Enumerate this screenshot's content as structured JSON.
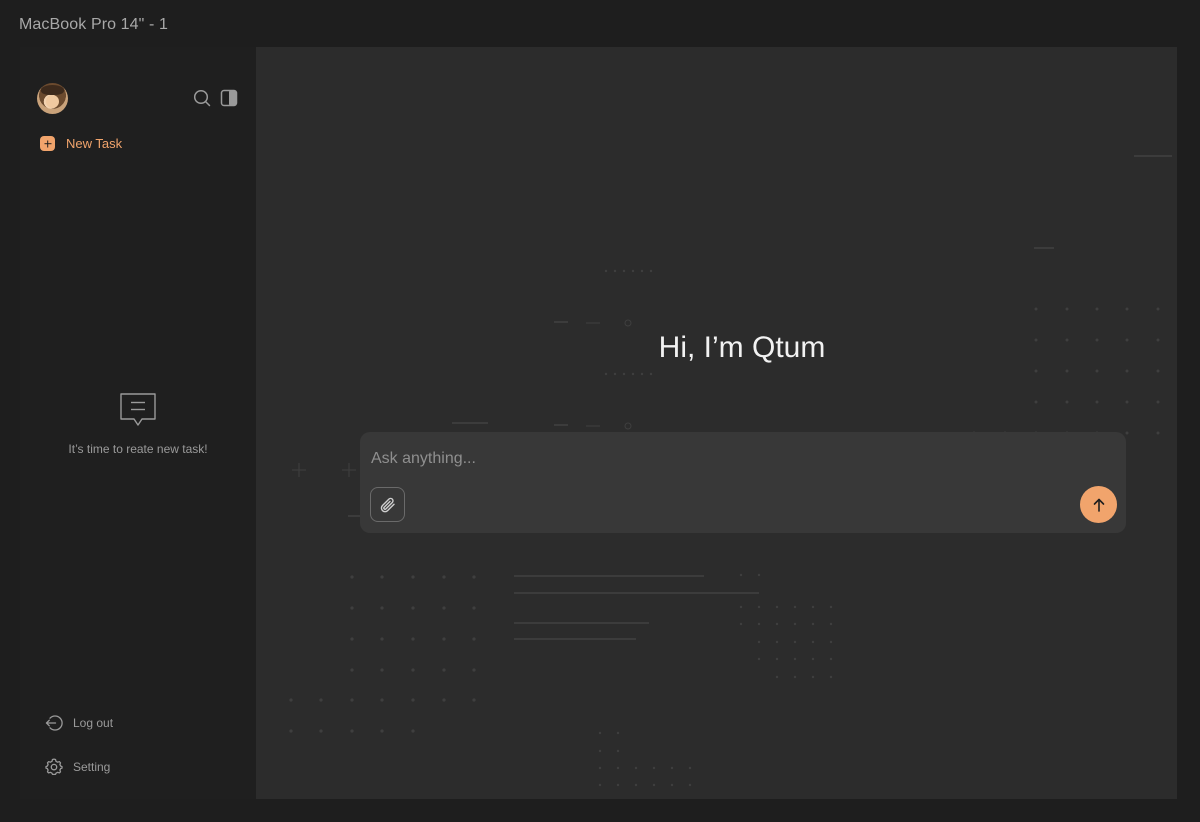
{
  "frame": {
    "title": "MacBook Pro 14\" - 1"
  },
  "sidebar": {
    "new_task_label": "New Task",
    "empty_message": "It’s time to reate new task!",
    "logout_label": "Log out",
    "setting_label": "Setting"
  },
  "main": {
    "greeting": "Hi, I’m Qtum",
    "input_placeholder": "Ask anything..."
  },
  "colors": {
    "accent": "#f1a46c",
    "sidebar_bg": "#1f1f1f",
    "main_bg": "#2c2c2c",
    "input_bg": "#383838"
  },
  "icons": [
    "search-icon",
    "sidebar-toggle-icon",
    "plus-icon",
    "chat-bubble-icon",
    "logout-icon",
    "gear-icon",
    "paperclip-icon",
    "arrow-up-icon"
  ]
}
